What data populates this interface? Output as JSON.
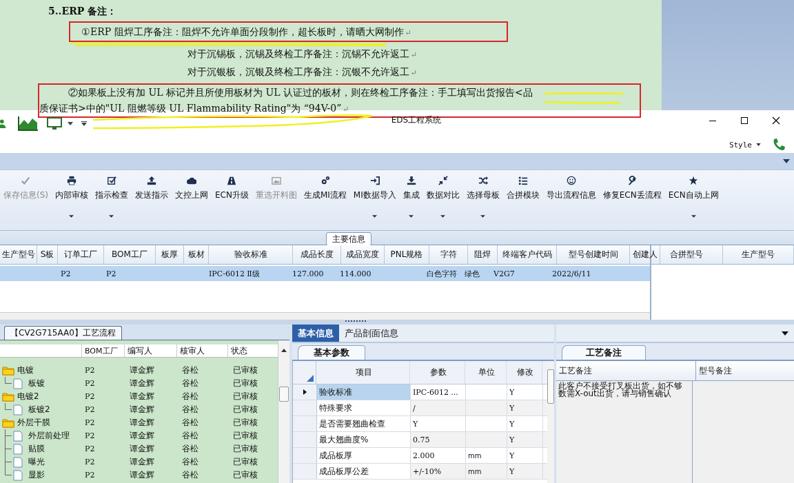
{
  "document": {
    "heading": "5..ERP 备注：",
    "paragraphs": [
      {
        "kind": "boxed",
        "lines": [
          "①ERP 阻焊工序备注：阻焊不允许单面分段制作，超长板时，请晒大网制作"
        ],
        "mark": "↵"
      },
      {
        "kind": "plain",
        "lines": [
          "对于沉锡板，沉锡及终检工序备注：沉锡不允许返工"
        ],
        "mark": "↵"
      },
      {
        "kind": "plain",
        "lines": [
          "对于沉银板，沉银及终检工序备注：沉银不允许返工"
        ],
        "mark": "↵"
      },
      {
        "kind": "boxed",
        "lines": [
          "②如果板上没有加 UL 标记并且所使用板材为 UL 认证过的板材，则在终检工序备注：手工填写出货报告<品",
          "质保证书>中的\"UL 阻燃等级 UL Flammability Rating\"为 “94V-0”"
        ],
        "mark": "↵"
      }
    ]
  },
  "window": {
    "title": "EDS工程系统",
    "style_menu": "Style"
  },
  "toolbar": [
    {
      "label": "保存信息(S)",
      "disabled": true,
      "dropdown": false
    },
    {
      "label": "内部审核",
      "disabled": false,
      "dropdown": true
    },
    {
      "label": "指示检查",
      "disabled": false,
      "dropdown": true
    },
    {
      "label": "发送指示",
      "disabled": false,
      "dropdown": false
    },
    {
      "label": "文控上网",
      "disabled": false,
      "dropdown": false
    },
    {
      "label": "ECN升级",
      "disabled": false,
      "dropdown": false
    },
    {
      "label": "重选开料图",
      "disabled": true,
      "dropdown": false
    },
    {
      "label": "生成MI流程",
      "disabled": false,
      "dropdown": false
    },
    {
      "label": "MI数据导入",
      "disabled": false,
      "dropdown": true
    },
    {
      "label": "集成",
      "disabled": false,
      "dropdown": true
    },
    {
      "label": "数据对比",
      "disabled": false,
      "dropdown": true
    },
    {
      "label": "选择母板",
      "disabled": false,
      "dropdown": true
    },
    {
      "label": "合拼模块",
      "disabled": false,
      "dropdown": false
    },
    {
      "label": "导出流程信息",
      "disabled": false,
      "dropdown": false
    },
    {
      "label": "修复ECN丢流程",
      "disabled": false,
      "dropdown": false
    },
    {
      "label": "ECN自动上网",
      "disabled": false,
      "dropdown": true
    }
  ],
  "main_info": {
    "title": "主要信息",
    "columns": [
      "生产型号",
      "S板",
      "订单工厂",
      "BOM工厂",
      "板厚",
      "板材",
      "验收标准",
      "成品长度",
      "成品宽度",
      "PNL规格",
      "字符",
      "阻焊",
      "终端客户代码",
      "型号创建时间",
      "创建人"
    ],
    "rows": [
      {
        "selected": true,
        "cells": [
          "",
          "",
          "P2",
          "P2",
          "",
          "",
          "IPC-6012 Ⅱ级",
          "127.000",
          "114.000",
          "",
          "白色字符",
          "绿色",
          "V2G7",
          "2022/6/11",
          ""
        ]
      }
    ],
    "side_columns": [
      "合拼型号",
      "生产型号"
    ]
  },
  "process_flow": {
    "tab": "【CV2G715AA0】工艺流程",
    "columns": [
      "BOM工厂",
      "编写人",
      "核审人",
      "状态"
    ],
    "rows": [
      {
        "name": "电镀",
        "bom": "P2",
        "writer": "谭金辉",
        "reviewer": "谷松",
        "status": "已审核",
        "children": [
          {
            "name": "板镀",
            "bom": "P2",
            "writer": "谭金辉",
            "reviewer": "谷松",
            "status": "已审核"
          }
        ]
      },
      {
        "name": "电镀2",
        "bom": "P2",
        "writer": "谭金辉",
        "reviewer": "谷松",
        "status": "已审核",
        "children": [
          {
            "name": "板镀2",
            "bom": "P2",
            "writer": "谭金辉",
            "reviewer": "谷松",
            "status": "已审核"
          }
        ]
      },
      {
        "name": "外层干膜",
        "bom": "P2",
        "writer": "谭金辉",
        "reviewer": "谷松",
        "status": "已审核",
        "children": [
          {
            "name": "外层前处理",
            "bom": "P2",
            "writer": "谭金辉",
            "reviewer": "谷松",
            "status": "已审核"
          },
          {
            "name": "贴膜",
            "bom": "P2",
            "writer": "谭金辉",
            "reviewer": "谷松",
            "status": "已审核"
          },
          {
            "name": "曝光",
            "bom": "P2",
            "writer": "谭金辉",
            "reviewer": "谷松",
            "status": "已审核"
          },
          {
            "name": "显影",
            "bom": "P2",
            "writer": "谭金辉",
            "reviewer": "谷松",
            "status": "已审核"
          }
        ]
      }
    ]
  },
  "params": {
    "tabs": [
      {
        "label": "基本信息",
        "selected": true
      },
      {
        "label": "产品剖面信息",
        "selected": false
      }
    ],
    "subtab": "基本参数",
    "columns": [
      "项目",
      "参数",
      "单位",
      "修改"
    ],
    "rows": [
      {
        "item": "验收标准",
        "value": "IPC-6012 ...",
        "modify": "Y",
        "selected": true
      },
      {
        "item": "特殊要求",
        "value": "/",
        "modify": "Y",
        "selected": false
      },
      {
        "item": "是否需要翘曲检查",
        "value": "Y",
        "modify": "Y",
        "selected": false
      },
      {
        "item": "最大翘曲度%",
        "value": "0.75",
        "modify": "Y",
        "selected": false
      },
      {
        "item": "成品板厚",
        "value": "2.000",
        "unit": "mm",
        "modify": "Y",
        "selected": false
      },
      {
        "item": "成品板厚公差",
        "value": "+/-10%",
        "unit": "mm",
        "modify": "Y",
        "selected": false
      }
    ]
  },
  "notes": {
    "tab": "工艺备注",
    "columns": [
      "工艺备注",
      "型号备注"
    ],
    "process_note": "此客户不接受打叉板出货，如不够数需X-out出货，请与销售确认"
  }
}
